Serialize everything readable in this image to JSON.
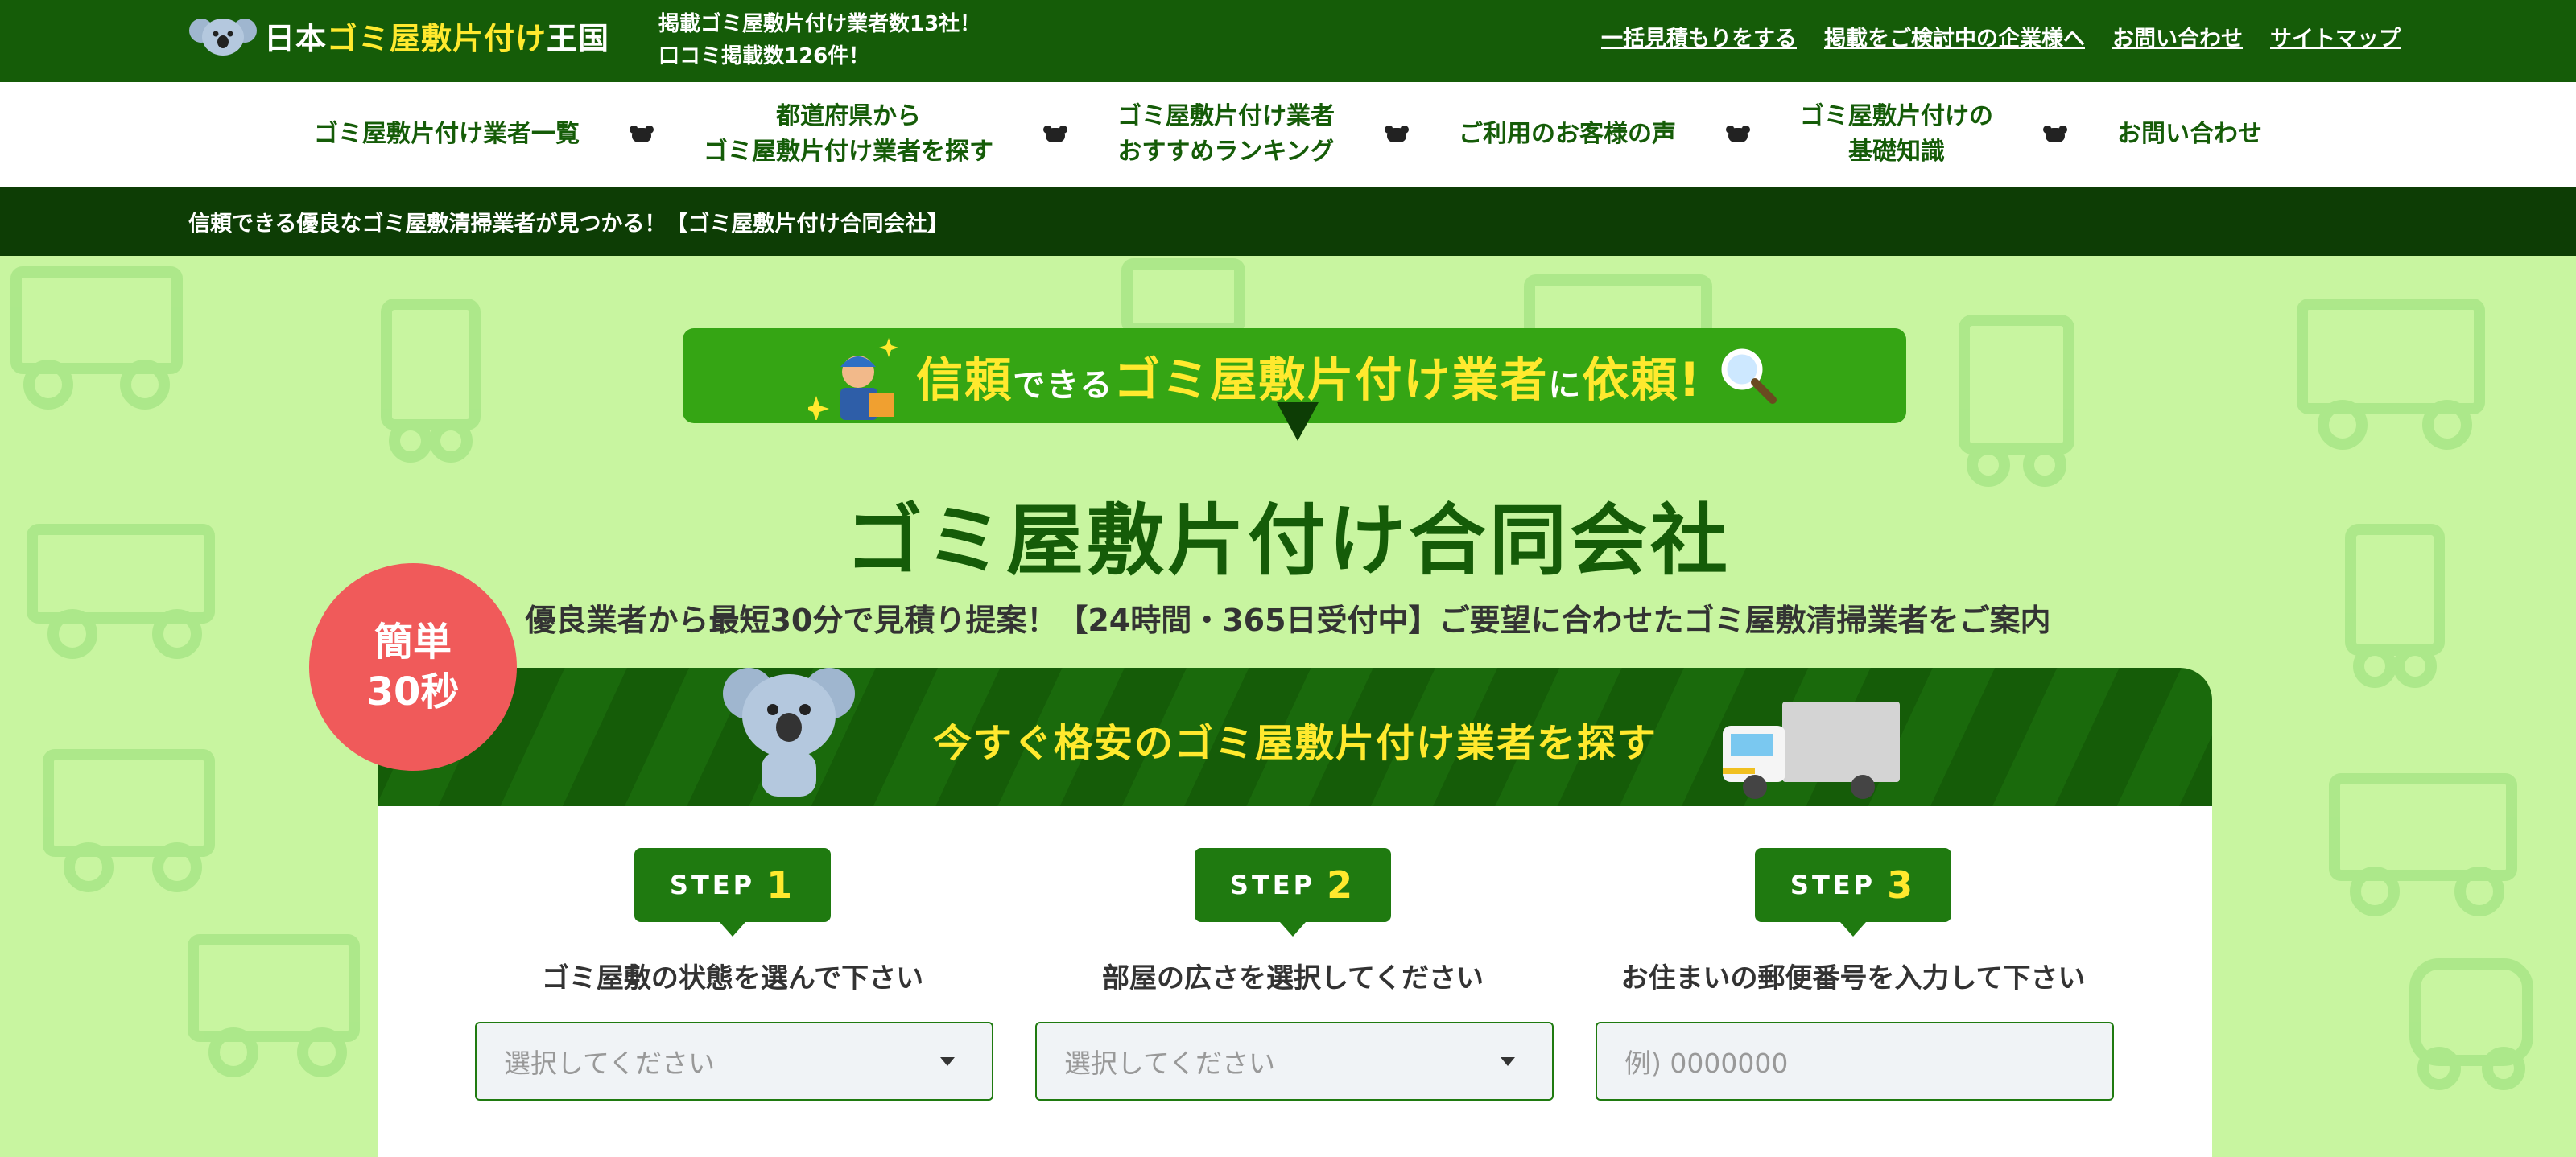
{
  "header": {
    "logo_prefix": "日本",
    "logo_highlight": "ゴミ屋敷片付け",
    "logo_suffix": "王国",
    "info_line1": "掲載ゴミ屋敷片付け業者数13社！",
    "info_line2": "口コミ掲載数126件！",
    "links": [
      "一括見積もりをする",
      "掲載をご検討中の企業様へ",
      "お問い合わせ",
      "サイトマップ"
    ]
  },
  "nav": {
    "items": [
      {
        "line1": "ゴミ屋敷片付け業者一覧",
        "line2": ""
      },
      {
        "line1": "都道府県から",
        "line2": "ゴミ屋敷片付け業者を探す"
      },
      {
        "line1": "ゴミ屋敷片付け業者",
        "line2": "おすすめランキング"
      },
      {
        "line1": "ご利用のお客様の声",
        "line2": ""
      },
      {
        "line1": "ゴミ屋敷片付けの",
        "line2": "基礎知識"
      },
      {
        "line1": "お問い合わせ",
        "line2": ""
      }
    ]
  },
  "breadcrumb": "信頼できる優良なゴミ屋敷清掃業者が見つかる！【ゴミ屋敷片付け合同会社】",
  "banner": {
    "part1": "信頼",
    "part2": "できる",
    "part3": "ゴミ屋敷片付け業者",
    "part4": "に",
    "part5": "依頼!"
  },
  "main": {
    "title": "ゴミ屋敷片付け合同会社",
    "subtitle": "優良業者から最短30分で見積り提案！【24時間・365日受付中】ご要望に合わせたゴミ屋敷清掃業者をご案内"
  },
  "badge": {
    "line1": "簡単",
    "line2": "30秒"
  },
  "form": {
    "heading": "今すぐ格安のゴミ屋敷片付け業者を探す",
    "steps": [
      {
        "word": "STEP",
        "num": "1",
        "label": "ゴミ屋敷の状態を選んで下さい",
        "placeholder": "選択してください"
      },
      {
        "word": "STEP",
        "num": "2",
        "label": "部屋の広さを選択してください",
        "placeholder": "選択してください"
      },
      {
        "word": "STEP",
        "num": "3",
        "label": "お住まいの郵便番号を入力して下さい",
        "placeholder": "例) 0000000"
      }
    ]
  },
  "colors": {
    "dark_green": "#155c08",
    "accent_yellow": "#ffe92e",
    "bg_green": "#c8f5a0",
    "badge_red": "#f05a5a"
  }
}
